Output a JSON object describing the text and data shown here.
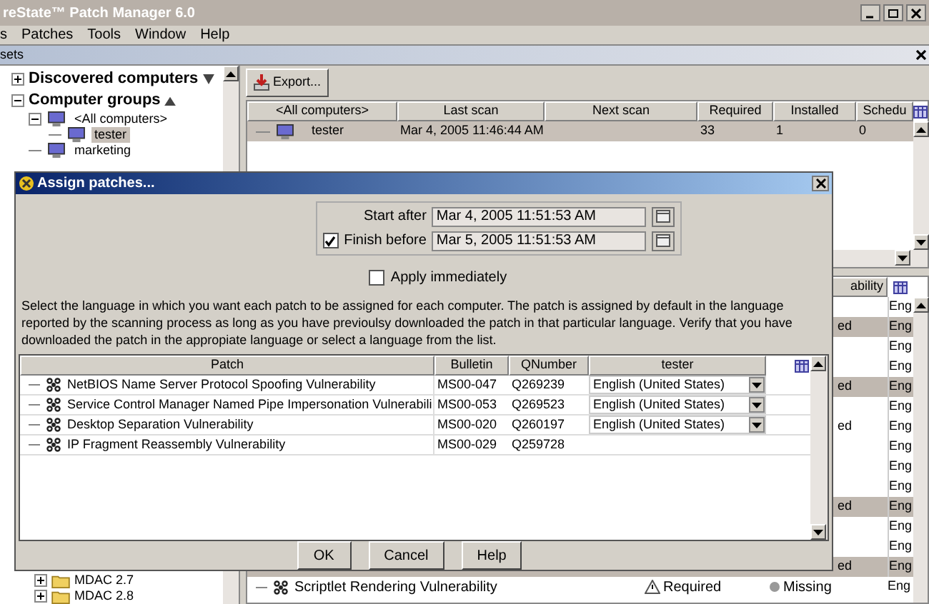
{
  "window": {
    "title": "reState™ Patch Manager 6.0"
  },
  "menu": [
    {
      "label": "s"
    },
    {
      "label": "Patches"
    },
    {
      "label": "Tools"
    },
    {
      "label": "Window"
    },
    {
      "label": "Help"
    }
  ],
  "tab": {
    "label": "sets"
  },
  "tree": {
    "sections": [
      {
        "label": "Discovered computers",
        "expanded": false
      },
      {
        "label": "Computer groups",
        "expanded": true,
        "children": [
          {
            "label": "<All computers>",
            "selected": false,
            "children": [
              {
                "label": "tester",
                "selected": true
              }
            ]
          },
          {
            "label": "marketing",
            "selected": false
          }
        ]
      }
    ],
    "bottom_items": [
      {
        "label": "MDAC 2.7"
      },
      {
        "label": "MDAC 2.8"
      }
    ]
  },
  "computers": {
    "export_button": "Export...",
    "columns": [
      "<All computers>",
      "Last scan",
      "Next scan",
      "Required",
      "Installed",
      "Schedu"
    ],
    "rows": [
      {
        "name": "tester",
        "last_scan": "Mar 4, 2005 11:46:44 AM",
        "required": "33",
        "installed": "1",
        "scheduled": "0",
        "selected": true
      }
    ]
  },
  "patches": {
    "state_column": "ability",
    "hidden_rows": [
      {
        "language": "Eng",
        "selected": false
      },
      {
        "status": "ed",
        "language": "Eng",
        "selected": true
      },
      {
        "language": "Eng",
        "selected": false
      },
      {
        "language": "Eng",
        "selected": false
      },
      {
        "status": "ed",
        "language": "Eng",
        "selected": true
      },
      {
        "language": "Eng",
        "selected": false
      },
      {
        "status": "ed",
        "language": "Eng",
        "selected": false
      },
      {
        "language": "Eng",
        "selected": false
      },
      {
        "language": "Eng",
        "selected": false
      },
      {
        "language": "Eng",
        "selected": false
      },
      {
        "status": "ed",
        "language": "Eng",
        "selected": true
      },
      {
        "language": "Eng",
        "selected": false
      },
      {
        "language": "Eng",
        "selected": false
      },
      {
        "status": "ed",
        "language": "Eng",
        "selected": true
      }
    ],
    "rows": [
      {
        "patch": "Scriptlet Rendering Vulnerability",
        "requirement": "Required",
        "state": "Missing",
        "language": "Eng"
      }
    ]
  },
  "dialog": {
    "title": "Assign patches...",
    "start_after": {
      "label": "Start after",
      "value": "Mar 4, 2005 11:51:53 AM"
    },
    "finish_before": {
      "label": "Finish before",
      "value": "Mar 5, 2005 11:51:53 AM",
      "checked": true
    },
    "apply_immediately": {
      "label": "Apply immediately",
      "checked": false
    },
    "instructions": "Select the language in which you want each patch to be assigned for each computer.  The patch is assigned by default in the language reported by the scanning process as long as you have previoulsy downloaded the patch in that particular language. Verify that you have downloaded the patch in the appropiate language or select a language from the list.",
    "table": {
      "columns": [
        "Patch",
        "Bulletin",
        "QNumber",
        "tester"
      ],
      "rows": [
        {
          "patch": "NetBIOS Name Server Protocol Spoofing Vulnerability",
          "bulletin": "MS00-047",
          "qnumber": "Q269239",
          "language": "English (United States)"
        },
        {
          "patch": "Service Control Manager Named Pipe Impersonation Vulnerabili",
          "bulletin": "MS00-053",
          "qnumber": "Q269523",
          "language": "English (United States)"
        },
        {
          "patch": "Desktop Separation Vulnerability",
          "bulletin": "MS00-020",
          "qnumber": "Q260197",
          "language": "English (United States)"
        },
        {
          "patch": "IP Fragment Reassembly Vulnerability",
          "bulletin": "MS00-029",
          "qnumber": "Q259728"
        }
      ]
    },
    "buttons": [
      {
        "label": "OK"
      },
      {
        "label": "Cancel"
      },
      {
        "label": "Help"
      }
    ]
  }
}
